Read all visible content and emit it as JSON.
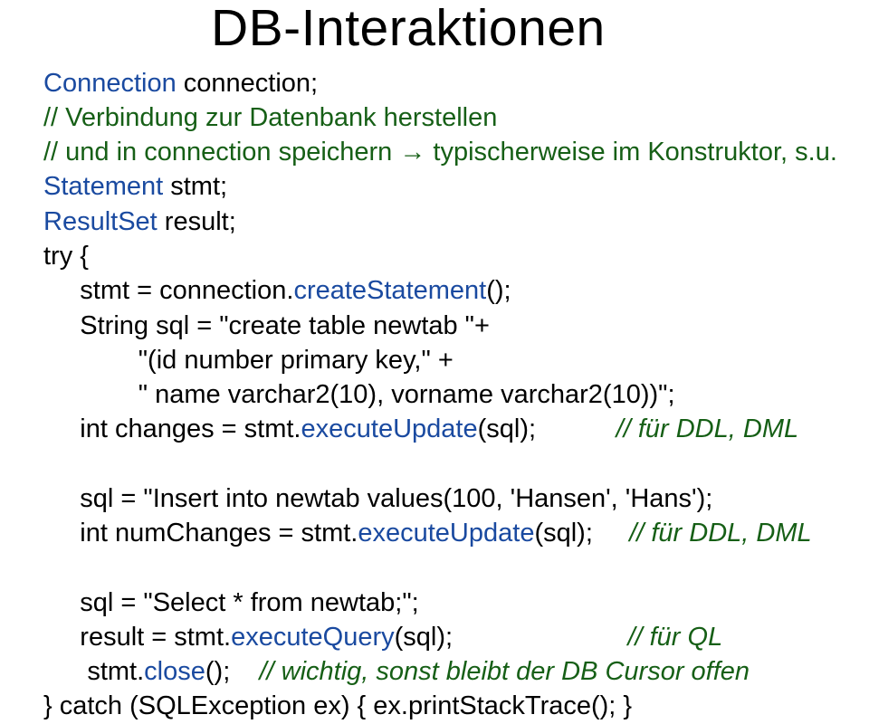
{
  "title": "DB-Interaktionen",
  "code": {
    "l01a": "Connection",
    "l01b": " connection;",
    "l02": "// Verbindung zur Datenbank herstellen",
    "l03a": "// und in connection speichern ",
    "l03arrow": "→",
    "l03b": " typischerweise im Konstruktor, s.u.",
    "l04a": "Statement",
    "l04b": " stmt;",
    "l05a": "ResultSet",
    "l05b": " result;",
    "l06": "try {",
    "l07a": "     stmt = connection.",
    "l07b": "createStatement",
    "l07c": "();",
    "l08": "     String sql = \"create table newtab \"+ ",
    "l09": "             \"(id number primary key,\" +",
    "l10": "             \" name varchar2(10), vorname varchar2(10))\";",
    "l11a": "     int changes = stmt.",
    "l11b": "executeUpdate",
    "l11c": "(sql);           ",
    "l11d": "// für DDL, DML",
    "blank1": "",
    "l12": "     sql = \"Insert into newtab values(100, 'Hansen', 'Hans');",
    "l13a": "     int numChanges = stmt.",
    "l13b": "executeUpdate",
    "l13c": "(sql);     ",
    "l13d": "// für DDL, DML",
    "blank2": "",
    "l14": "     sql = \"Select * from newtab;\";",
    "l15a": "     result = stmt.",
    "l15b": "executeQuery",
    "l15c": "(sql);                        ",
    "l15d": "// für QL",
    "l16a": "      stmt.",
    "l16b": "close",
    "l16c": "();    ",
    "l16d": "// wichtig, sonst bleibt der DB Cursor offen",
    "l17": "} catch (SQLException ex) { ex.printStackTrace(); }"
  }
}
